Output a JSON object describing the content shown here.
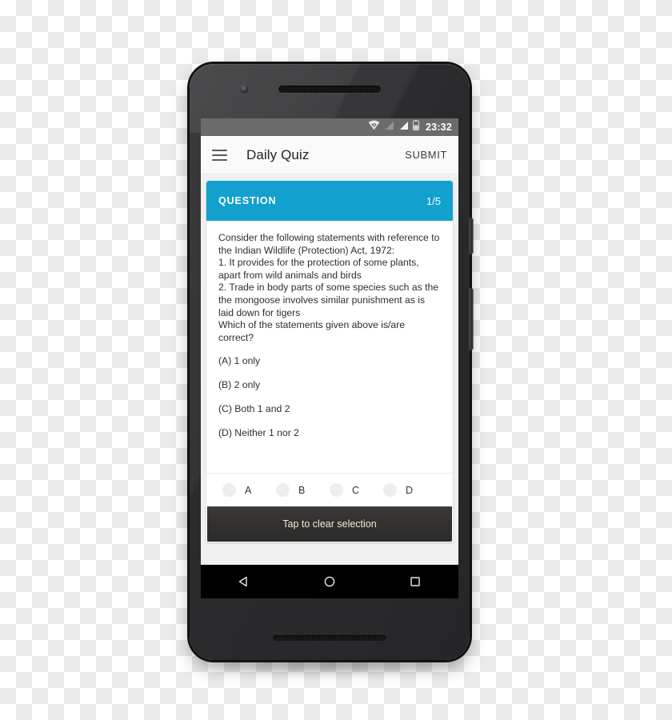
{
  "status_bar": {
    "wifi_icon": "wifi-icon",
    "signal_icon_1": "signal-bars-dim-icon",
    "signal_icon_2": "signal-bars-icon",
    "battery_icon": "battery-icon",
    "clock": "23:32"
  },
  "app_bar": {
    "menu_icon": "hamburger-menu-icon",
    "title": "Daily Quiz",
    "submit_label": "SUBMIT"
  },
  "quiz": {
    "header": {
      "label": "QUESTION",
      "counter": "1/5"
    },
    "question_text": "Consider the following statements with reference to the Indian Wildlife (Protection) Act, 1972:\n1. It provides for the protection of some plants, apart from wild animals and birds\n2. Trade in body parts of some species such as the the mongoose involves similar punishment as is laid down for tigers\nWhich of the statements given above is/are correct?",
    "options": [
      {
        "text": "(A) 1 only"
      },
      {
        "text": "(B) 2 only"
      },
      {
        "text": "(C) Both 1 and 2"
      },
      {
        "text": "(D) Neither 1 nor 2"
      }
    ],
    "radios": [
      {
        "label": "A",
        "selected": false
      },
      {
        "label": "B",
        "selected": false
      },
      {
        "label": "C",
        "selected": false
      },
      {
        "label": "D",
        "selected": false
      }
    ],
    "clear_button_label": "Tap to clear selection"
  },
  "nav_bar": {
    "back_icon": "back-triangle-icon",
    "home_icon": "home-circle-icon",
    "recents_icon": "recents-square-icon"
  },
  "colors": {
    "accent_blue": "#12a0ce",
    "status_bar_gray": "#6b6b6b",
    "app_bar_bg": "#fafafa",
    "clear_button_text": "#f1ead0"
  }
}
